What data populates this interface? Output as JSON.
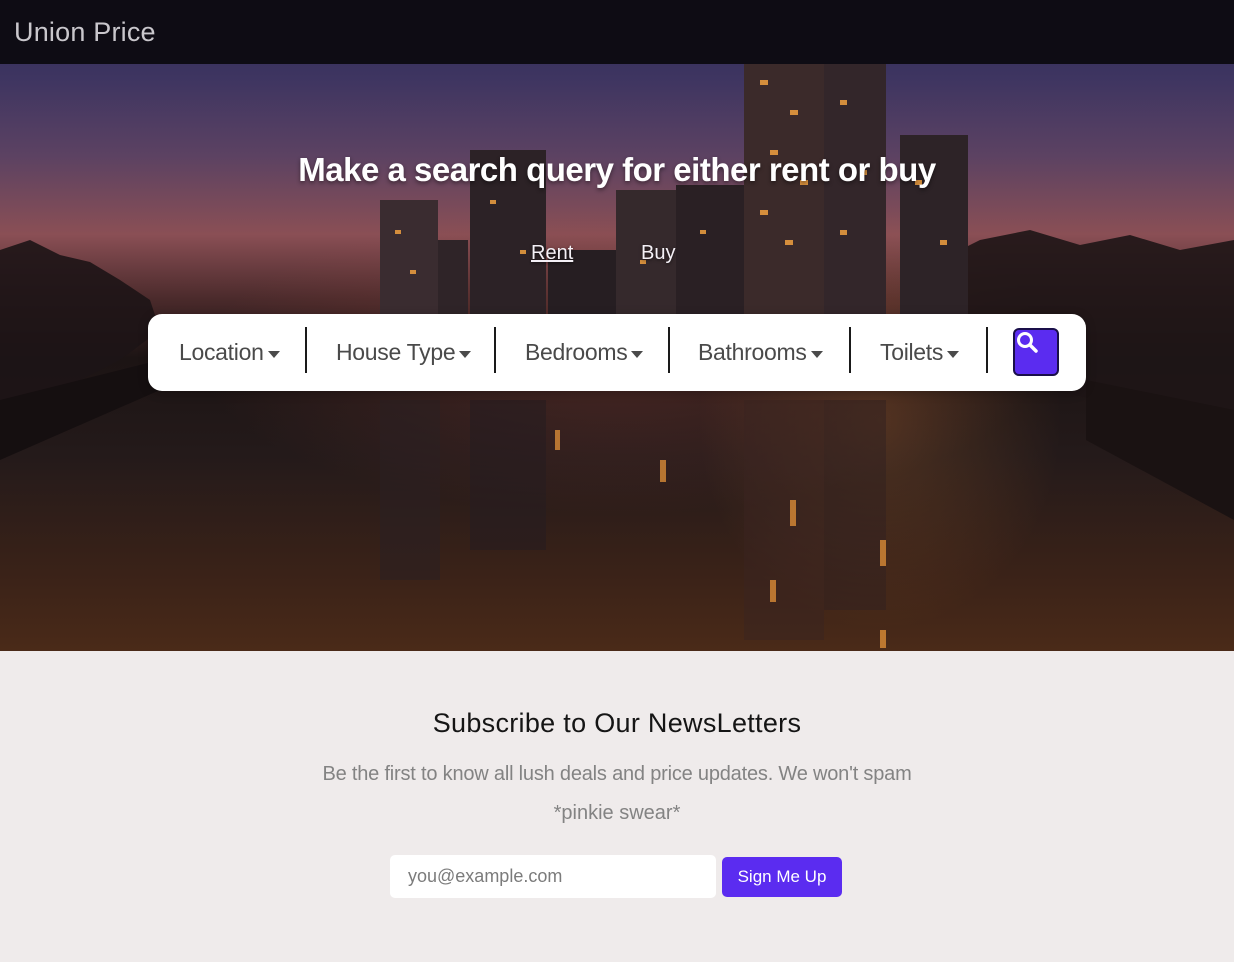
{
  "navbar": {
    "brand": "Union Price"
  },
  "hero": {
    "title": "Make a search query for either rent or buy",
    "tabs": [
      {
        "label": "Rent",
        "active": true
      },
      {
        "label": "Buy",
        "active": false
      }
    ]
  },
  "search": {
    "filters": [
      {
        "label": "Location"
      },
      {
        "label": "House Type"
      },
      {
        "label": "Bedrooms"
      },
      {
        "label": "Bathrooms"
      },
      {
        "label": "Toilets"
      }
    ],
    "button_icon": "search-icon"
  },
  "newsletter": {
    "title": "Subscribe to Our NewsLetters",
    "text_line1": "Be the first to know all lush deals and price updates. We won't spam",
    "text_line2": "*pinkie swear*",
    "email_placeholder": "you@example.com",
    "button_label": "Sign Me Up"
  },
  "colors": {
    "accent": "#5b2cf0",
    "navbar_bg": "#0e0c14",
    "section_bg": "#efebeb"
  }
}
